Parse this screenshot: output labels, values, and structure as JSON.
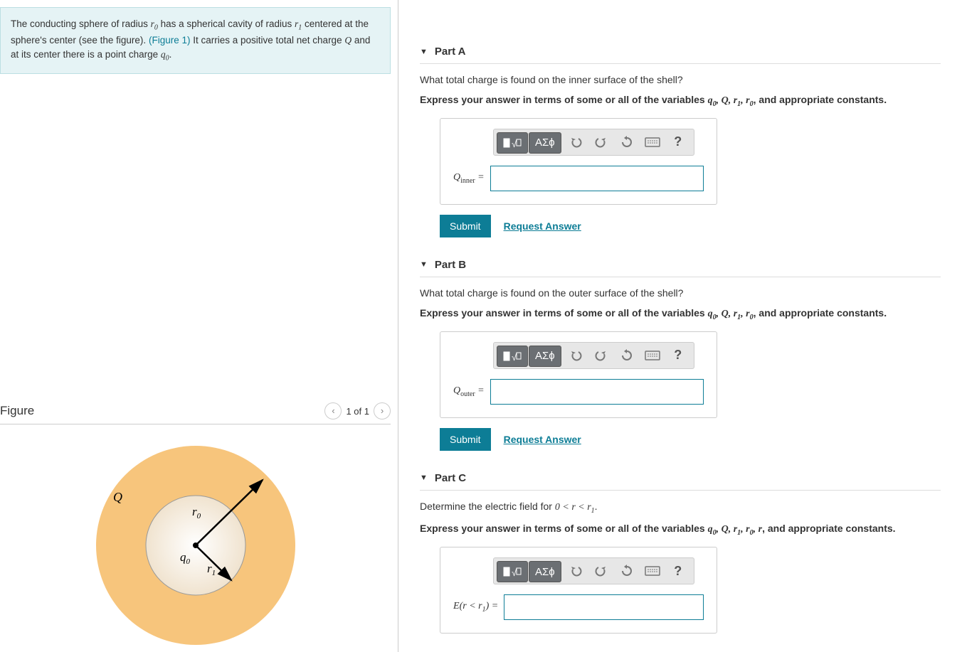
{
  "problem": {
    "text_before": "The conducting sphere of radius ",
    "r0": "r",
    "r0_sub": "0",
    "text_mid1": " has a spherical cavity of radius ",
    "r1": "r",
    "r1_sub": "1",
    "text_mid2": " centered at the sphere's center (see the figure).",
    "figure_link": "(Figure 1)",
    "text_mid3": " It carries a positive total net charge ",
    "Q": "Q",
    "text_mid4": " and at its center there is a point charge ",
    "q0": "q",
    "q0_sub": "0",
    "text_end": "."
  },
  "figure": {
    "title": "Figure",
    "pager": "1 of 1",
    "labels": {
      "Q": "Q",
      "r0": "r",
      "r0_sub": "0",
      "r1": "r",
      "r1_sub": "1",
      "q0": "q",
      "q0_sub": "0"
    }
  },
  "toolbar": {
    "templates": "▭√▭",
    "greek": "ΑΣϕ",
    "undo_icon": "undo",
    "redo_icon": "redo",
    "reset_icon": "reset",
    "keyboard_icon": "keyboard",
    "help": "?"
  },
  "parts": [
    {
      "id": "A",
      "label": "Part A",
      "question": "What total charge is found on the inner surface of the shell?",
      "hint_prefix": "Express your answer in terms of some or all of the variables ",
      "hint_vars": "q₀, Q, r₁, r₀",
      "hint_suffix": ", and appropriate constants.",
      "lhs_html": "Q_inner =",
      "lhs_main": "Q",
      "lhs_sub": "inner",
      "submit": "Submit",
      "request": "Request Answer"
    },
    {
      "id": "B",
      "label": "Part B",
      "question": "What total charge is found on the outer surface of the shell?",
      "hint_prefix": "Express your answer in terms of some or all of the variables ",
      "hint_vars": "q₀, Q, r₁, r₀",
      "hint_suffix": ", and appropriate constants.",
      "lhs_main": "Q",
      "lhs_sub": "outer",
      "submit": "Submit",
      "request": "Request Answer"
    },
    {
      "id": "C",
      "label": "Part C",
      "question_prefix": "Determine the electric field for ",
      "question_math": "0 < r < r₁",
      "question_suffix": ".",
      "hint_prefix": "Express your answer in terms of some or all of the variables ",
      "hint_vars": "q₀, Q, r₁, r₀, r",
      "hint_suffix": ", and appropriate constants.",
      "lhs_literal": "E(r < r₁) ="
    }
  ]
}
